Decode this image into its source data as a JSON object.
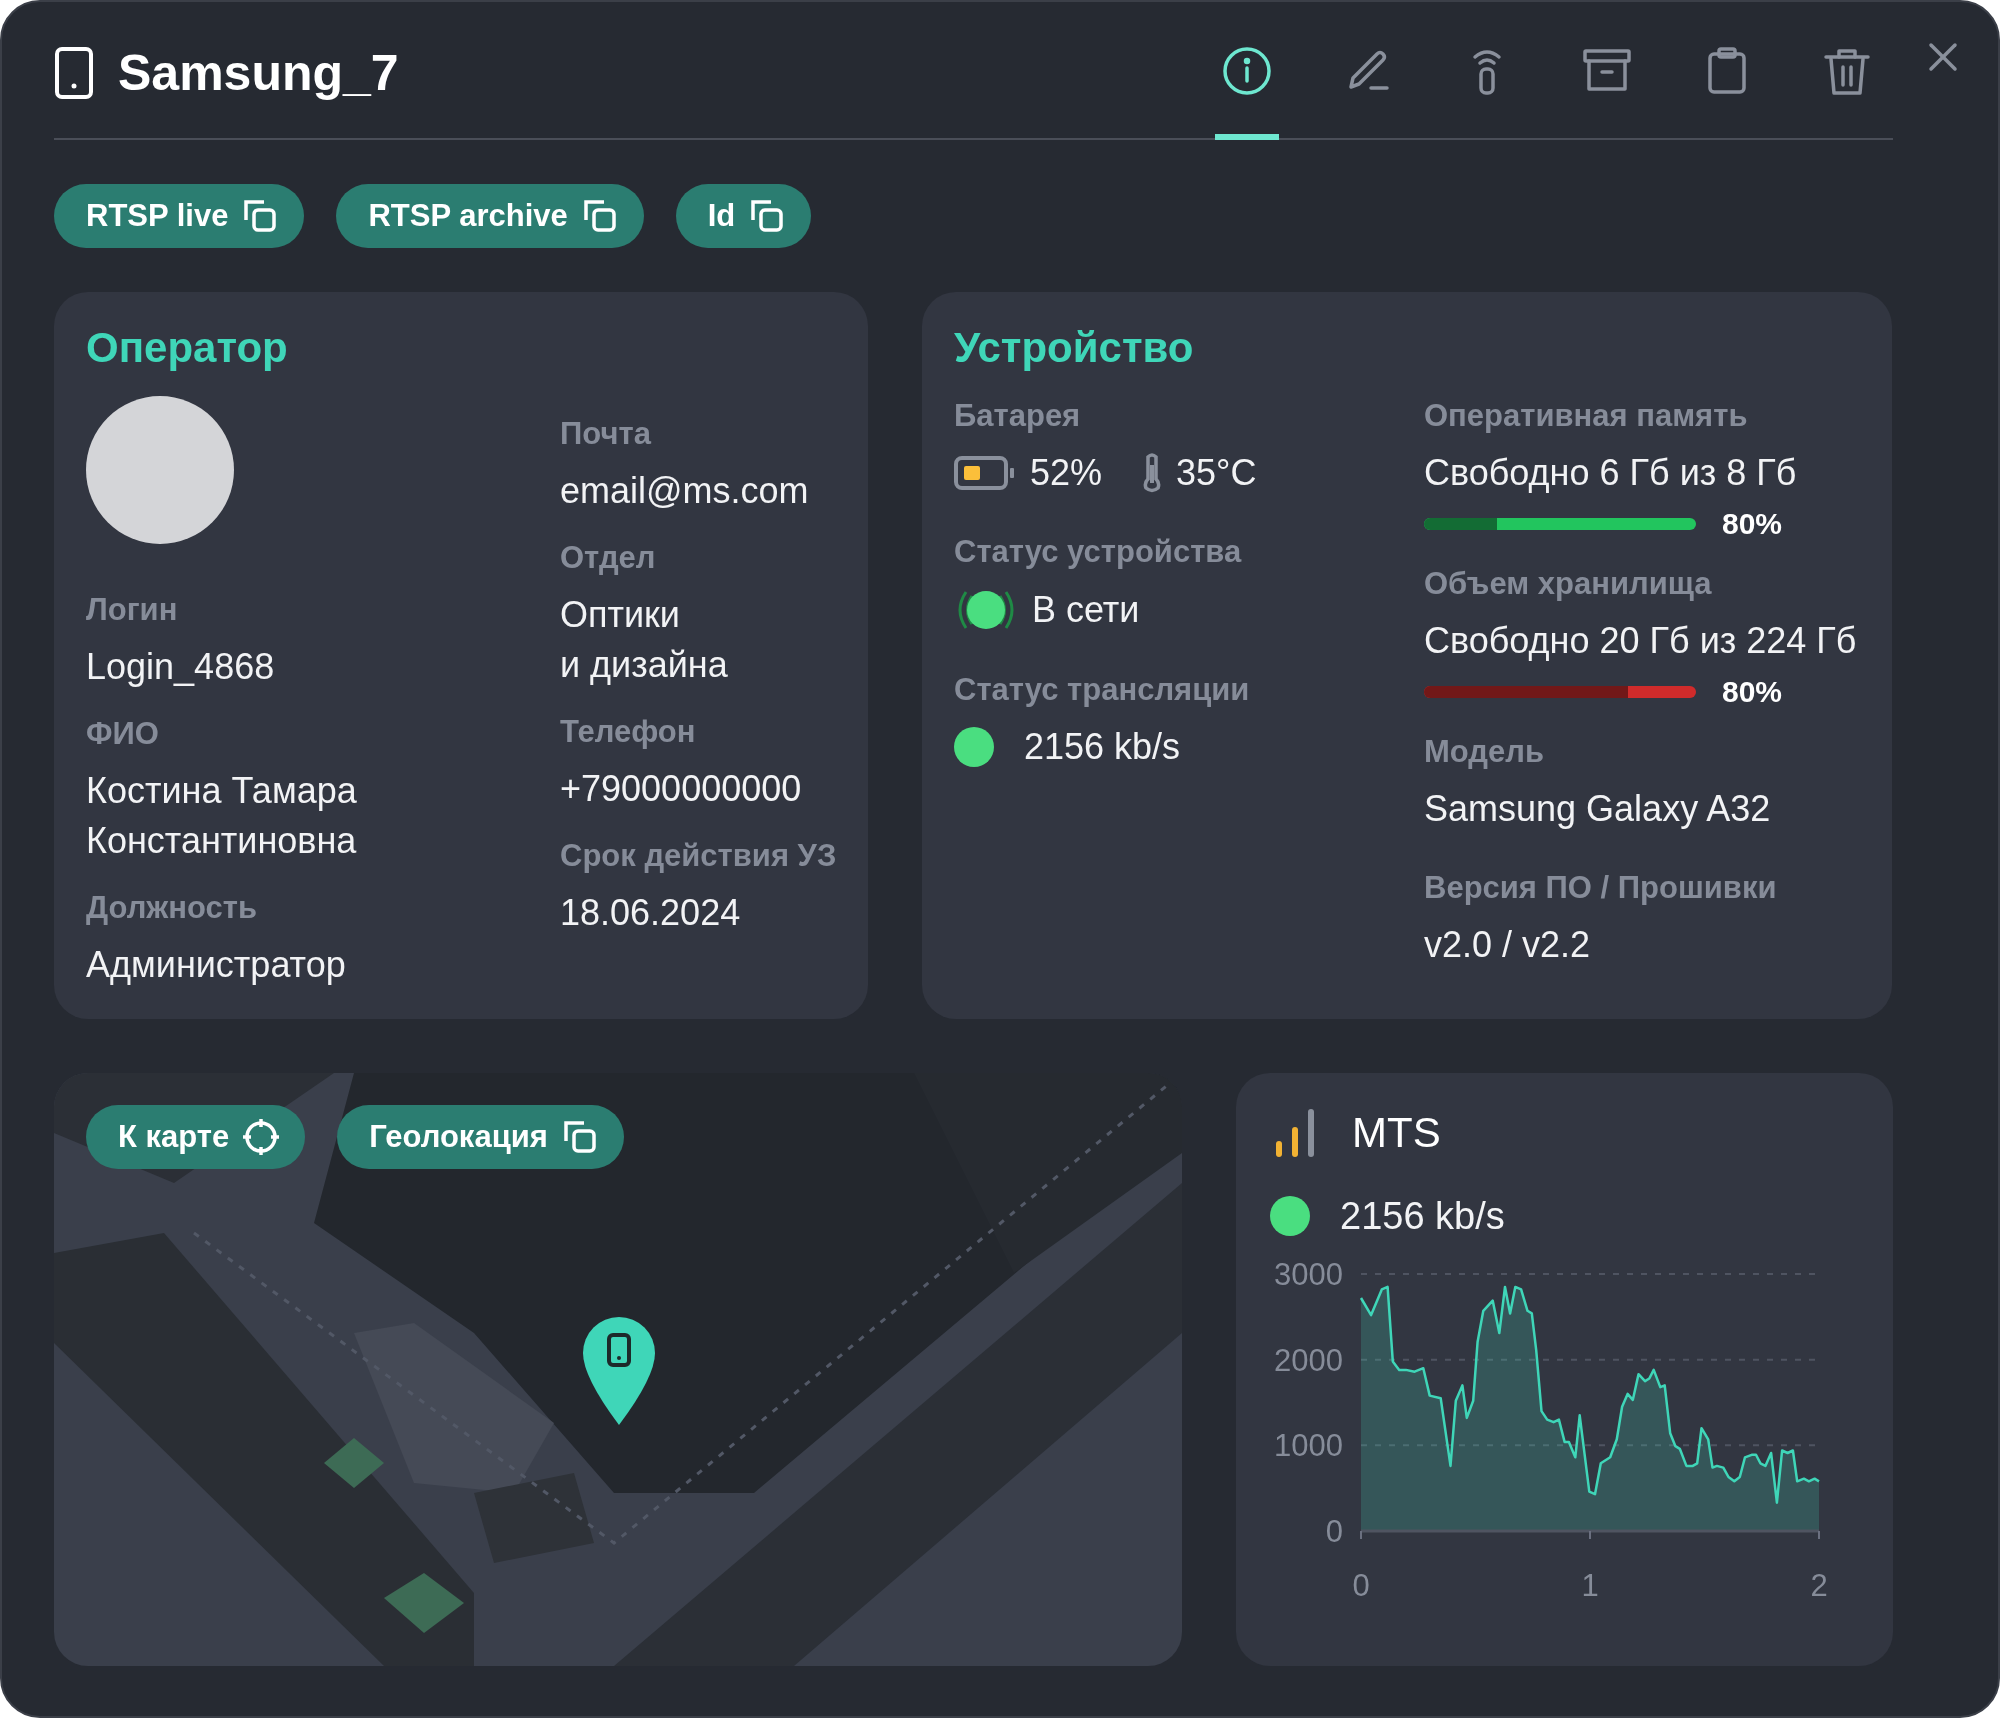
{
  "window": {
    "title": "Samsung_7"
  },
  "toolbar": [
    {
      "kind": "info",
      "selected": true
    },
    {
      "kind": "edit",
      "selected": false
    },
    {
      "kind": "antenna",
      "selected": false
    },
    {
      "kind": "archive",
      "selected": false
    },
    {
      "kind": "clipboard",
      "selected": false
    },
    {
      "kind": "trash",
      "selected": false
    }
  ],
  "copy_chips": [
    {
      "label": "RTSP live"
    },
    {
      "label": "RTSP archive"
    },
    {
      "label": "Id"
    }
  ],
  "operator": {
    "title": "Оператор",
    "left_fields": [
      {
        "label": "Логин",
        "value": "Login_4868"
      },
      {
        "label": "ФИО",
        "value": "Костина Тамара\nКонстантиновна"
      },
      {
        "label": "Должность",
        "value": "Администратор"
      }
    ],
    "right_fields": [
      {
        "label": "Почта",
        "value": "email@ms.com"
      },
      {
        "label": "Отдел",
        "value": "Оптики\nи дизайна"
      },
      {
        "label": "Телефон",
        "value": "+79000000000"
      },
      {
        "label": "Срок действия УЗ",
        "value": "18.06.2024"
      }
    ]
  },
  "device": {
    "title": "Устройство",
    "battery": {
      "label": "Батарея",
      "value": "52%",
      "temperature": "35°C"
    },
    "device_status": {
      "label": "Статус устройства",
      "value": "В сети",
      "color": "#4ade80"
    },
    "stream_status": {
      "label": "Статус трансляции",
      "value": "2156 kb/s",
      "color": "#4ade80"
    },
    "ram": {
      "label": "Оперативная память",
      "value": "Свободно 6 Гб из 8 Гб",
      "level": 0.27,
      "percent": "80%",
      "color": "#22c55e"
    },
    "storage": {
      "label": "Объем хранилища",
      "value": "Свободно 20 Гб из 224 Гб",
      "level": 0.75,
      "percent": "80%",
      "color": "#d02b2b"
    },
    "model": {
      "label": "Модель",
      "value": "Samsung Galaxy A32"
    },
    "firmware": {
      "label": "Версия ПО / Прошивки",
      "value": "v2.0 / v2.2"
    }
  },
  "map": {
    "buttons": [
      {
        "label": "К карте",
        "kind": "locate"
      },
      {
        "label": "Геолокация",
        "kind": "copy"
      }
    ]
  },
  "network": {
    "operator": "MTS",
    "status": {
      "value": "2156 kb/s",
      "color": "#4ade80"
    },
    "chart_data": {
      "type": "area",
      "xlim": [
        0,
        2
      ],
      "ylim": [
        0,
        3000
      ],
      "xticks": [
        0,
        1,
        2
      ],
      "yticks": [
        0,
        1000,
        2000,
        3000
      ],
      "x": [
        0,
        0.044,
        0.091,
        0.116,
        0.139,
        0.167,
        0.196,
        0.234,
        0.272,
        0.3,
        0.348,
        0.391,
        0.414,
        0.443,
        0.462,
        0.49,
        0.509,
        0.534,
        0.575,
        0.604,
        0.629,
        0.651,
        0.674,
        0.699,
        0.727,
        0.746,
        0.765,
        0.788,
        0.813,
        0.841,
        0.864,
        0.889,
        0.908,
        0.936,
        0.955,
        0.997,
        1.022,
        1.047,
        1.088,
        1.117,
        1.14,
        1.164,
        1.187,
        1.212,
        1.24,
        1.259,
        1.278,
        1.307,
        1.326,
        1.35,
        1.373,
        1.392,
        1.421,
        1.449,
        1.468,
        1.487,
        1.516,
        1.535,
        1.554,
        1.582,
        1.605,
        1.63,
        1.654,
        1.677,
        1.706,
        1.725,
        1.744,
        1.766,
        1.791,
        1.816,
        1.839,
        1.863,
        1.886,
        1.905,
        1.934,
        1.956,
        1.981,
        2
      ],
      "series": [
        {
          "color": "#3fd6b8",
          "values": [
            2720,
            2520,
            2820,
            2850,
            1980,
            1880,
            1880,
            1860,
            1900,
            1580,
            1550,
            760,
            1520,
            1700,
            1320,
            1520,
            2210,
            2570,
            2690,
            2310,
            2850,
            2540,
            2850,
            2820,
            2570,
            2540,
            2110,
            1400,
            1300,
            1270,
            1300,
            1040,
            1040,
            860,
            1350,
            460,
            430,
            790,
            860,
            1070,
            1450,
            1600,
            1530,
            1830,
            1750,
            1780,
            1880,
            1680,
            1700,
            1140,
            990,
            960,
            760,
            760,
            790,
            1200,
            1070,
            740,
            760,
            740,
            630,
            580,
            630,
            860,
            890,
            890,
            790,
            760,
            910,
            330,
            940,
            910,
            940,
            580,
            610,
            580,
            610,
            580
          ]
        }
      ]
    }
  }
}
